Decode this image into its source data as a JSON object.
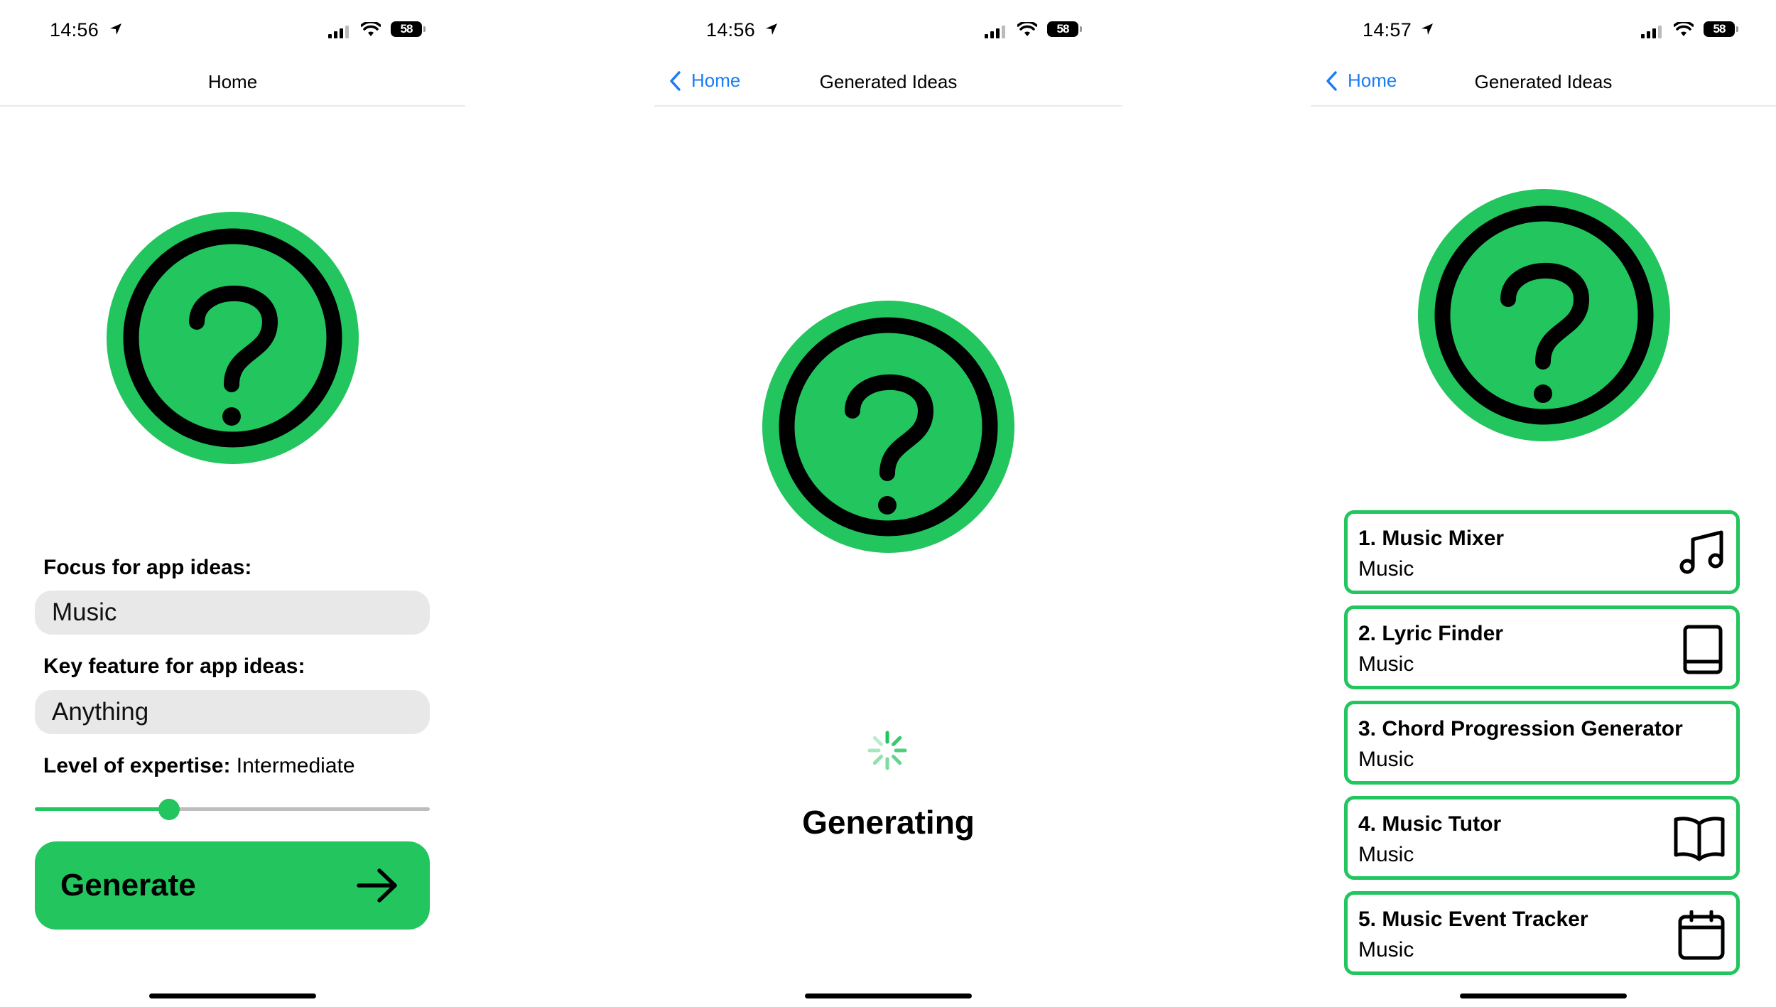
{
  "colors": {
    "accent": "#22c55e",
    "link": "#1a7cf5",
    "field_bg": "#e8e8e8"
  },
  "screen1": {
    "status": {
      "time": "14:56",
      "battery": "58"
    },
    "nav_title": "Home",
    "focus_label": "Focus for app ideas:",
    "focus_value": "Music",
    "feature_label": "Key feature for app ideas:",
    "feature_value": "Anything",
    "level_label": "Level of expertise:",
    "level_value": "Intermediate",
    "level_fraction": 0.34,
    "generate_label": "Generate",
    "icons": [
      "question-circle-icon",
      "arrow-right-icon"
    ]
  },
  "screen2": {
    "status": {
      "time": "14:56",
      "battery": "58"
    },
    "back_label": "Home",
    "nav_title": "Generated Ideas",
    "generating_label": "Generating",
    "icons": [
      "question-circle-icon",
      "spinner-icon"
    ]
  },
  "screen3": {
    "status": {
      "time": "14:57",
      "battery": "58"
    },
    "back_label": "Home",
    "nav_title": "Generated Ideas",
    "ideas": [
      {
        "title": "1. Music Mixer",
        "category": "Music",
        "icon": "music-note-icon"
      },
      {
        "title": "2. Lyric Finder",
        "category": "Music",
        "icon": "book-icon"
      },
      {
        "title": "3. Chord Progression Generator",
        "category": "Music",
        "icon": ""
      },
      {
        "title": "4. Music Tutor",
        "category": "Music",
        "icon": "open-book-icon"
      },
      {
        "title": "5. Music Event Tracker",
        "category": "Music",
        "icon": "calendar-icon"
      }
    ]
  }
}
